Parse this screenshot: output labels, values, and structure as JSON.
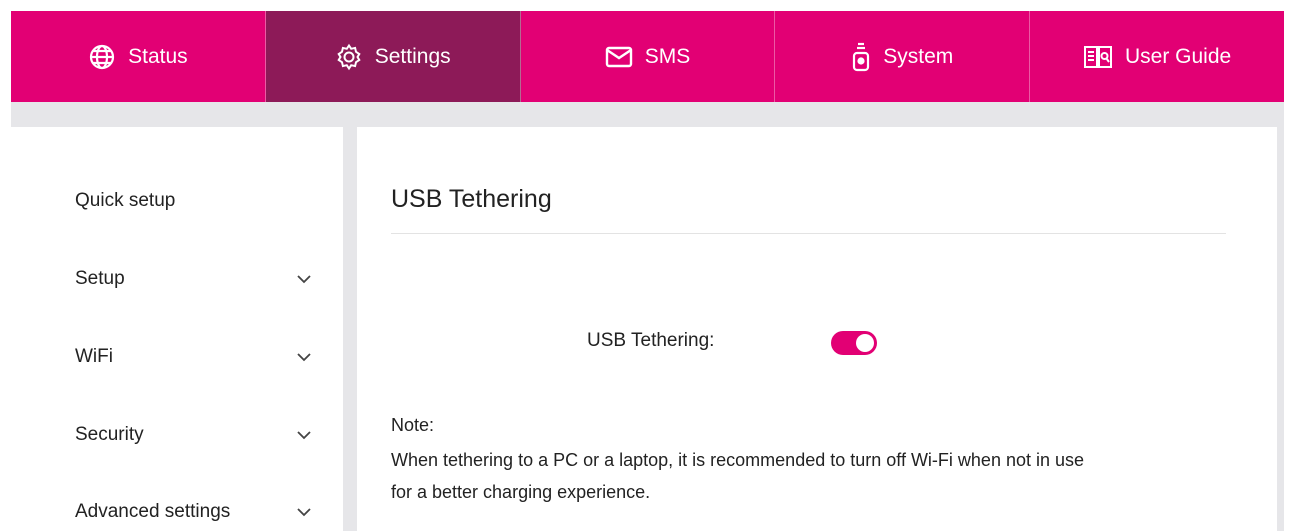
{
  "nav": {
    "tabs": [
      {
        "label": "Status",
        "icon": "globe-icon"
      },
      {
        "label": "Settings",
        "icon": "gear-icon",
        "active": true
      },
      {
        "label": "SMS",
        "icon": "envelope-icon"
      },
      {
        "label": "System",
        "icon": "device-icon"
      },
      {
        "label": "User Guide",
        "icon": "book-icon"
      }
    ],
    "accent_color": "#e20074",
    "active_color": "#8d1a58"
  },
  "sidebar": {
    "items": [
      {
        "label": "Quick setup",
        "icon": null
      },
      {
        "label": "Setup",
        "icon": "chevron-down-icon"
      },
      {
        "label": "WiFi",
        "icon": "chevron-down-icon"
      },
      {
        "label": "Security",
        "icon": "chevron-down-icon"
      },
      {
        "label": "Advanced settings",
        "icon": "chevron-down-icon"
      }
    ]
  },
  "main": {
    "title": "USB Tethering",
    "field_label": "USB Tethering:",
    "toggle_on": true,
    "note_heading": "Note:",
    "note_line1": "When tethering to a PC or a laptop, it is recommended to turn off Wi-Fi when not in use",
    "note_line2": "for a better charging experience."
  }
}
